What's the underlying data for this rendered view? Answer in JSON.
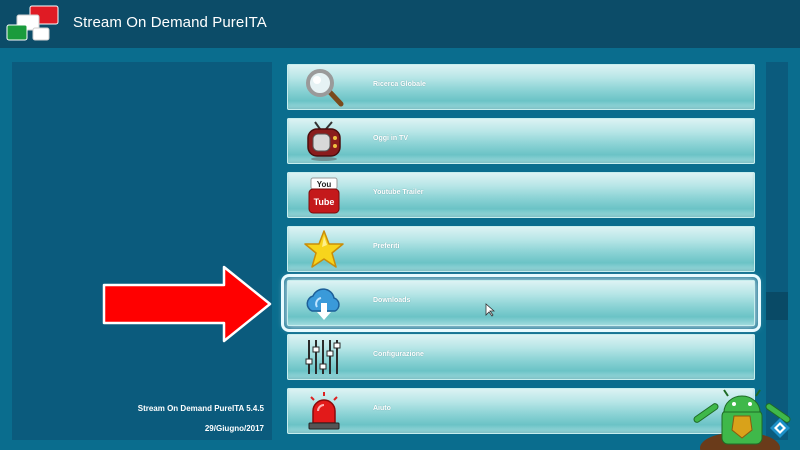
{
  "header": {
    "title": "Stream On Demand PureITA",
    "logo_icon": "pureita-logo-icon"
  },
  "info_panel": {
    "version": "Stream On Demand PureITA 5.4.5",
    "date": "29/Giugno/2017"
  },
  "menu": {
    "items": [
      {
        "label": "Ricerca Globale",
        "icon": "magnifier-icon"
      },
      {
        "label": "Oggi in TV",
        "icon": "retro-tv-icon"
      },
      {
        "label": "Youtube Trailer",
        "icon": "youtube-icon"
      },
      {
        "label": "Preferiti",
        "icon": "star-icon"
      },
      {
        "label": "Downloads",
        "icon": "cloud-download-icon"
      },
      {
        "label": "Configurazione",
        "icon": "equalizer-sliders-icon"
      },
      {
        "label": "Aiuto",
        "icon": "alarm-siren-icon"
      }
    ],
    "selected_index": 4
  },
  "annotation": {
    "arrow_color": "#ff0000",
    "watermark_icon": "android-mascot-watermark-icon"
  },
  "colors": {
    "background": "#0a6d8e",
    "header": "#0c4c68",
    "panel": "#0b5b7d",
    "menu_item": "#8ed4d6"
  }
}
